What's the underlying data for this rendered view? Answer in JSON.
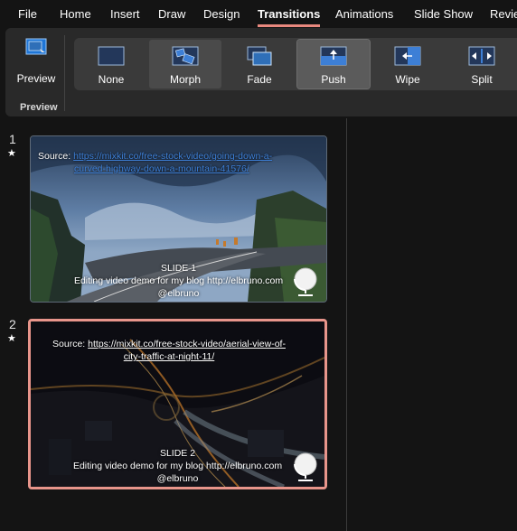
{
  "menu": {
    "tabs": [
      "File",
      "Home",
      "Insert",
      "Draw",
      "Design",
      "Transitions",
      "Animations",
      "Slide Show",
      "Revie"
    ],
    "active": "Transitions"
  },
  "ribbon": {
    "preview_label": "Preview",
    "group_label": "Preview",
    "transitions": [
      "None",
      "Morph",
      "Fade",
      "Push",
      "Wipe",
      "Split"
    ],
    "selected": "Push",
    "accent": "#1e75d6"
  },
  "slides": [
    {
      "number": "1",
      "star": "★",
      "source_prefix": "Source: ",
      "source_line1": "https://mixkit.co/free-stock-video/going-down-a-",
      "source_line2": "curved-highway-down-a-mountain-41576/",
      "title": "SLIDE 1",
      "subtitle_line1": "Editing video demo for my blog http://elbruno.com",
      "subtitle_line2": "@elbruno"
    },
    {
      "number": "2",
      "star": "★",
      "source_prefix": "Source: ",
      "source_line1": "https://mixkit.co/free-stock-video/aerial-view-of-",
      "source_line2": "city-traffic-at-night-11/",
      "title": "SLIDE 2",
      "subtitle_line1": "Editing video demo for my blog http://elbruno.com",
      "subtitle_line2": "@elbruno",
      "selected": true
    }
  ],
  "colors": {
    "selected_slide_border": "#e8958b",
    "active_tab_underline": "#e9897f"
  }
}
